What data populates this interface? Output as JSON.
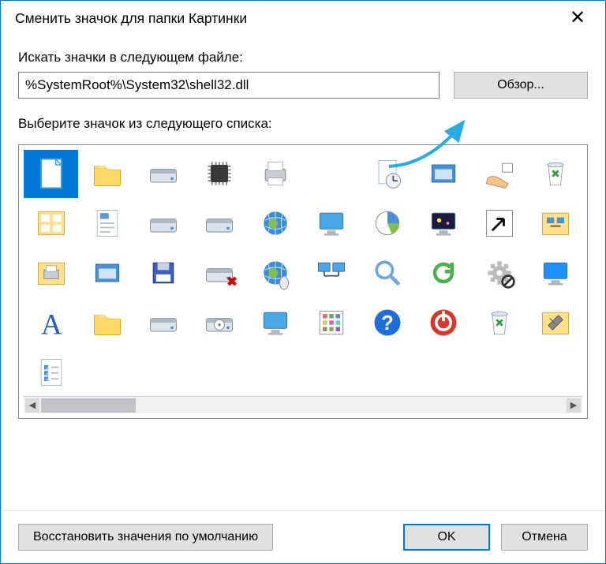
{
  "title": "Сменить значок для папки Картинки",
  "labels": {
    "search_in_file": "Искать значки в следующем файле:",
    "choose_from_list": "Выберите значок из следующего списка:"
  },
  "path_input": {
    "value": "%SystemRoot%\\System32\\shell32.dll"
  },
  "buttons": {
    "browse": "Обзор...",
    "restore": "Восстановить значения по умолчанию",
    "ok": "OK",
    "cancel": "Отмена"
  },
  "icons": [
    {
      "id": 0,
      "name": "blank-file",
      "selected": true
    },
    {
      "id": 1,
      "name": "folder"
    },
    {
      "id": 2,
      "name": "drive"
    },
    {
      "id": 3,
      "name": "chip"
    },
    {
      "id": 4,
      "name": "printer"
    },
    {
      "id": 5,
      "name": "empty"
    },
    {
      "id": 6,
      "name": "recent-docs"
    },
    {
      "id": 7,
      "name": "window"
    },
    {
      "id": 8,
      "name": "run-hand"
    },
    {
      "id": 9,
      "name": "recycle-bin"
    },
    {
      "id": 10,
      "name": "control-panel"
    },
    {
      "id": 11,
      "name": "text-doc"
    },
    {
      "id": 12,
      "name": "floppy-drive"
    },
    {
      "id": 13,
      "name": "network-drive"
    },
    {
      "id": 14,
      "name": "globe"
    },
    {
      "id": 15,
      "name": "monitor"
    },
    {
      "id": 16,
      "name": "pie-chart"
    },
    {
      "id": 17,
      "name": "screensaver"
    },
    {
      "id": 18,
      "name": "shortcut-arrow"
    },
    {
      "id": 19,
      "name": "network-folder"
    },
    {
      "id": 20,
      "name": "printer-folder"
    },
    {
      "id": 21,
      "name": "app-window"
    },
    {
      "id": 22,
      "name": "floppy"
    },
    {
      "id": 23,
      "name": "drive-error"
    },
    {
      "id": 24,
      "name": "globe-mouse"
    },
    {
      "id": 25,
      "name": "network-pc"
    },
    {
      "id": 26,
      "name": "search"
    },
    {
      "id": 27,
      "name": "refresh"
    },
    {
      "id": 28,
      "name": "gear-disabled"
    },
    {
      "id": 29,
      "name": "desktop"
    },
    {
      "id": 30,
      "name": "font"
    },
    {
      "id": 31,
      "name": "folder-open"
    },
    {
      "id": 32,
      "name": "drive-blue"
    },
    {
      "id": 33,
      "name": "cd-drive"
    },
    {
      "id": 34,
      "name": "pc"
    },
    {
      "id": 35,
      "name": "programs"
    },
    {
      "id": 36,
      "name": "help"
    },
    {
      "id": 37,
      "name": "power"
    },
    {
      "id": 38,
      "name": "recycle-full"
    },
    {
      "id": 39,
      "name": "tools-folder"
    },
    {
      "id": 40,
      "name": "checklist"
    }
  ]
}
